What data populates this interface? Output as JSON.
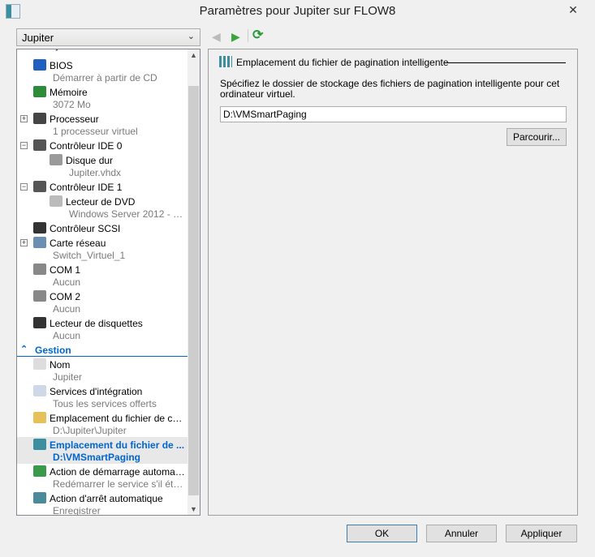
{
  "window": {
    "title": "Paramètres pour Jupiter sur FLOW8",
    "close": "✕"
  },
  "vm_selector": {
    "value": "Jupiter"
  },
  "nav": {
    "back": "◀",
    "forward": "▶",
    "refresh": "⟳"
  },
  "tree": [
    {
      "label": "Ajouter un matériel",
      "sub": null,
      "indent": 1,
      "icon": "add-hardware-icon",
      "clip": true
    },
    {
      "label": "BIOS",
      "sub": "Démarrer à partir de CD",
      "indent": 1,
      "icon": "bios-icon",
      "color": "#1f5fbf"
    },
    {
      "label": "Mémoire",
      "sub": "3072 Mo",
      "indent": 1,
      "icon": "memory-icon",
      "color": "#2e8b3a"
    },
    {
      "label": "Processeur",
      "sub": "1 processeur virtuel",
      "indent": 1,
      "icon": "processor-icon",
      "color": "#444444",
      "expander": "+"
    },
    {
      "label": "Contrôleur IDE 0",
      "sub": null,
      "indent": 1,
      "icon": "ide-controller-icon",
      "color": "#555555",
      "expander": "−"
    },
    {
      "label": "Disque dur",
      "sub": "Jupiter.vhdx",
      "indent": 2,
      "icon": "hard-disk-icon",
      "color": "#9a9a9a"
    },
    {
      "label": "Contrôleur IDE 1",
      "sub": null,
      "indent": 1,
      "icon": "ide-controller-icon",
      "color": "#555555",
      "expander": "−"
    },
    {
      "label": "Lecteur de DVD",
      "sub": "Windows Server 2012 - 64 ...",
      "indent": 2,
      "icon": "dvd-icon",
      "color": "#bbbbbb"
    },
    {
      "label": "Contrôleur SCSI",
      "sub": null,
      "indent": 1,
      "icon": "scsi-controller-icon",
      "color": "#333333"
    },
    {
      "label": "Carte réseau",
      "sub": "Switch_Virtuel_1",
      "indent": 1,
      "icon": "network-adapter-icon",
      "color": "#6a8fb0",
      "expander": "+"
    },
    {
      "label": "COM 1",
      "sub": "Aucun",
      "indent": 1,
      "icon": "com-port-icon",
      "color": "#888888"
    },
    {
      "label": "COM 2",
      "sub": "Aucun",
      "indent": 1,
      "icon": "com-port-icon",
      "color": "#888888"
    },
    {
      "label": "Lecteur de disquettes",
      "sub": "Aucun",
      "indent": 1,
      "icon": "floppy-icon",
      "color": "#333333"
    },
    {
      "section": true,
      "label": "Gestion",
      "icon": "collapse-section-icon",
      "glyph": "⌃"
    },
    {
      "label": "Nom",
      "sub": "Jupiter",
      "indent": 1,
      "icon": "name-icon",
      "color": "#dddddd"
    },
    {
      "label": "Services d'intégration",
      "sub": "Tous les services offerts",
      "indent": 1,
      "icon": "integration-services-icon",
      "color": "#cfd8e6"
    },
    {
      "label": "Emplacement du fichier de capt...",
      "sub": "D:\\Jupiter\\Jupiter",
      "indent": 1,
      "icon": "checkpoint-folder-icon",
      "color": "#e6c15a"
    },
    {
      "label": "Emplacement du fichier de ...",
      "sub": "D:\\VMSmartPaging",
      "indent": 1,
      "icon": "smart-paging-icon",
      "color": "#3b8f9e",
      "selected": true
    },
    {
      "label": "Action de démarrage automatique",
      "sub": "Redémarrer le service s'il était ...",
      "indent": 1,
      "icon": "auto-start-icon",
      "color": "#3a9a4a"
    },
    {
      "label": "Action d'arrêt automatique",
      "sub": "Enregistrer",
      "indent": 1,
      "icon": "auto-stop-icon",
      "color": "#4a8a9a"
    }
  ],
  "panel": {
    "title": "Emplacement du fichier de pagination intelligente",
    "description": "Spécifiez le dossier de stockage des fichiers de pagination intelligente pour cet ordinateur virtuel.",
    "path_value": "D:\\VMSmartPaging",
    "browse": "Parcourir..."
  },
  "footer": {
    "ok": "OK",
    "cancel": "Annuler",
    "apply": "Appliquer"
  }
}
